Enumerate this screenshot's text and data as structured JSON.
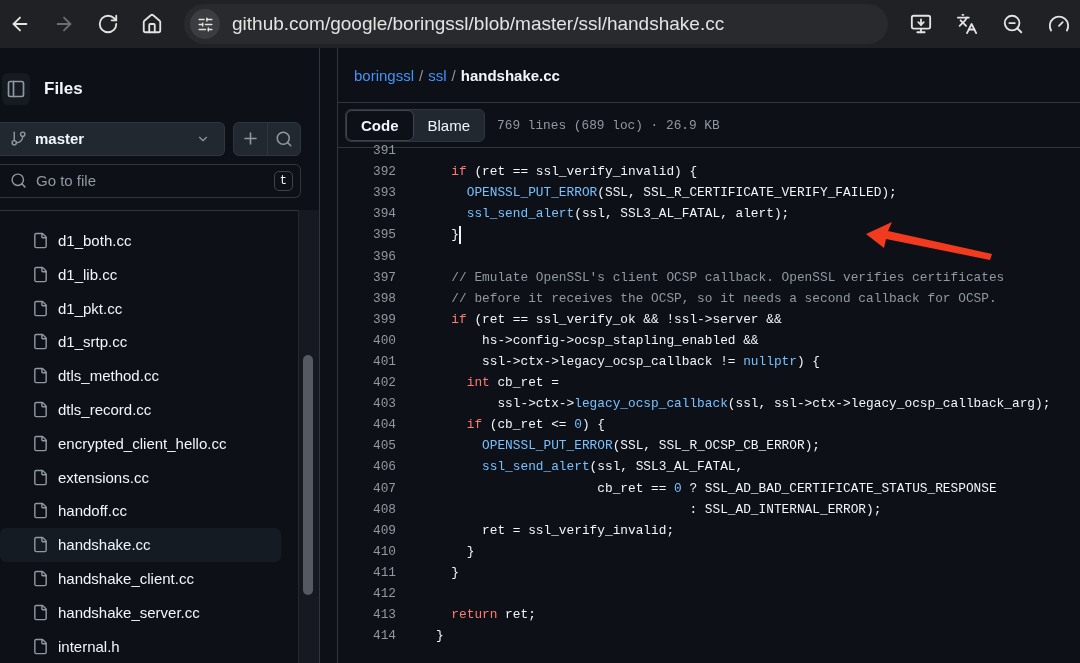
{
  "browser": {
    "nav_buttons": [
      {
        "kind": "back",
        "disabled": false
      },
      {
        "kind": "forward",
        "disabled": true
      },
      {
        "kind": "reload",
        "disabled": false
      },
      {
        "kind": "home",
        "disabled": false
      }
    ],
    "url": "github.com/google/boringssl/blob/master/ssl/handshake.cc",
    "tools": [
      {
        "kind": "install"
      },
      {
        "kind": "translate"
      },
      {
        "kind": "zoom"
      },
      {
        "kind": "performance"
      }
    ]
  },
  "sidebar": {
    "title": "Files",
    "branch": "master",
    "search": {
      "placeholder": "Go to file",
      "shortcut": "t"
    },
    "files": [
      {
        "name": "d1_both.cc",
        "selected": false
      },
      {
        "name": "d1_lib.cc",
        "selected": false
      },
      {
        "name": "d1_pkt.cc",
        "selected": false
      },
      {
        "name": "d1_srtp.cc",
        "selected": false
      },
      {
        "name": "dtls_method.cc",
        "selected": false
      },
      {
        "name": "dtls_record.cc",
        "selected": false
      },
      {
        "name": "encrypted_client_hello.cc",
        "selected": false
      },
      {
        "name": "extensions.cc",
        "selected": false
      },
      {
        "name": "handoff.cc",
        "selected": false
      },
      {
        "name": "handshake.cc",
        "selected": true
      },
      {
        "name": "handshake_client.cc",
        "selected": false
      },
      {
        "name": "handshake_server.cc",
        "selected": false
      },
      {
        "name": "internal.h",
        "selected": false
      }
    ]
  },
  "breadcrumb": [
    {
      "label": "boringssl",
      "kind": "link"
    },
    {
      "label": "/",
      "kind": "sep"
    },
    {
      "label": "ssl",
      "kind": "link"
    },
    {
      "label": "/",
      "kind": "sep"
    },
    {
      "label": "handshake.cc",
      "kind": "current"
    }
  ],
  "view_tabs": [
    {
      "label": "Code",
      "selected": true
    },
    {
      "label": "Blame",
      "selected": false
    }
  ],
  "file_info": "769 lines (689 loc) · 26.9 KB",
  "code": [
    {
      "number": "391"
    },
    {
      "number": "392",
      "segments": [
        {
          "kind": "keyword",
          "text": "  if"
        },
        {
          "kind": "plain",
          "text": " (ret == ssl_verify_invalid) {"
        }
      ]
    },
    {
      "number": "393",
      "segments": [
        {
          "kind": "function",
          "text": "    OPENSSL_PUT_ERROR"
        },
        {
          "kind": "plain",
          "text": "(SSL, SSL_R_CERTIFICATE_VERIFY_FAILED);"
        }
      ]
    },
    {
      "number": "394",
      "segments": [
        {
          "kind": "function",
          "text": "    ssl_send_alert"
        },
        {
          "kind": "plain",
          "text": "(ssl, SSL3_AL_FATAL, alert);"
        }
      ]
    },
    {
      "number": "395",
      "cursor": true,
      "segments": [
        {
          "kind": "plain",
          "text": "  }"
        }
      ]
    },
    {
      "number": "396"
    },
    {
      "number": "397",
      "segments": [
        {
          "kind": "comment",
          "text": "  // Emulate OpenSSL's client OCSP callback. OpenSSL verifies certificates"
        }
      ]
    },
    {
      "number": "398",
      "segments": [
        {
          "kind": "comment",
          "text": "  // before it receives the OCSP, so it needs a second callback for OCSP."
        }
      ]
    },
    {
      "number": "399",
      "segments": [
        {
          "kind": "keyword",
          "text": "  if"
        },
        {
          "kind": "plain",
          "text": " (ret == ssl_verify_ok && !ssl->server &&"
        }
      ]
    },
    {
      "number": "400",
      "segments": [
        {
          "kind": "plain",
          "text": "      hs->config->ocsp_stapling_enabled &&"
        }
      ]
    },
    {
      "number": "401",
      "segments": [
        {
          "kind": "plain",
          "text": "      ssl->ctx->legacy_ocsp_callback != "
        },
        {
          "kind": "function",
          "text": "nullptr"
        },
        {
          "kind": "plain",
          "text": ") {"
        }
      ]
    },
    {
      "number": "402",
      "segments": [
        {
          "kind": "keyword",
          "text": "    int"
        },
        {
          "kind": "plain",
          "text": " cb_ret ="
        }
      ]
    },
    {
      "number": "403",
      "segments": [
        {
          "kind": "plain",
          "text": "        ssl->ctx->"
        },
        {
          "kind": "function",
          "text": "legacy_ocsp_callback"
        },
        {
          "kind": "plain",
          "text": "(ssl, ssl->ctx->legacy_ocsp_callback_arg);"
        }
      ]
    },
    {
      "number": "404",
      "segments": [
        {
          "kind": "keyword",
          "text": "    if"
        },
        {
          "kind": "plain",
          "text": " (cb_ret <= "
        },
        {
          "kind": "function",
          "text": "0"
        },
        {
          "kind": "plain",
          "text": ") {"
        }
      ]
    },
    {
      "number": "405",
      "segments": [
        {
          "kind": "function",
          "text": "      OPENSSL_PUT_ERROR"
        },
        {
          "kind": "plain",
          "text": "(SSL, SSL_R_OCSP_CB_ERROR);"
        }
      ]
    },
    {
      "number": "406",
      "segments": [
        {
          "kind": "function",
          "text": "      ssl_send_alert"
        },
        {
          "kind": "plain",
          "text": "(ssl, SSL3_AL_FATAL,"
        }
      ]
    },
    {
      "number": "407",
      "segments": [
        {
          "kind": "plain",
          "text": "                     cb_ret == "
        },
        {
          "kind": "function",
          "text": "0"
        },
        {
          "kind": "plain",
          "text": " ? SSL_AD_BAD_CERTIFICATE_STATUS_RESPONSE"
        }
      ]
    },
    {
      "number": "408",
      "segments": [
        {
          "kind": "plain",
          "text": "                                 : SSL_AD_INTERNAL_ERROR);"
        }
      ]
    },
    {
      "number": "409",
      "segments": [
        {
          "kind": "plain",
          "text": "      ret = ssl_verify_invalid;"
        }
      ]
    },
    {
      "number": "410",
      "segments": [
        {
          "kind": "plain",
          "text": "    }"
        }
      ]
    },
    {
      "number": "411",
      "segments": [
        {
          "kind": "plain",
          "text": "  }"
        }
      ]
    },
    {
      "number": "412"
    },
    {
      "number": "413",
      "segments": [
        {
          "kind": "keyword",
          "text": "  return"
        },
        {
          "kind": "plain",
          "text": " ret;"
        }
      ]
    },
    {
      "number": "414",
      "segments": [
        {
          "kind": "plain",
          "text": "}"
        }
      ]
    }
  ]
}
